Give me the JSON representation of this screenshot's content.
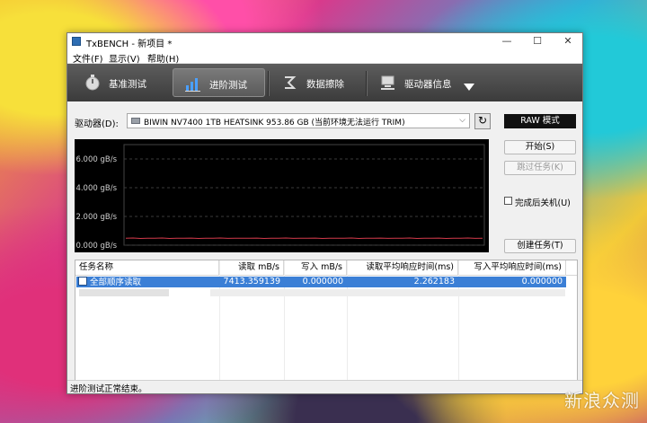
{
  "window": {
    "title": "TxBENCH - 新项目 *"
  },
  "controls": {
    "minimize": "—",
    "maximize": "☐",
    "close": "✕"
  },
  "menu": [
    "文件(F)",
    "显示(V)",
    "帮助(H)"
  ],
  "toolbar": {
    "tabs": [
      {
        "label": "基准测试",
        "icon": "stopwatch-icon",
        "active": false
      },
      {
        "label": "进阶测试",
        "icon": "bar-chart-icon",
        "active": true
      },
      {
        "label": "数据擦除",
        "icon": "erase-icon",
        "active": false
      },
      {
        "label": "驱动器信息",
        "icon": "drive-info-icon",
        "active": false
      }
    ]
  },
  "drive": {
    "label": "驱动器(D):",
    "selected": "BIWIN NV7400 1TB HEATSINK  953.86 GB (当前环境无法运行 TRIM)"
  },
  "right_panel": {
    "mode": "RAW 模式",
    "start": "开始(S)",
    "skip": "跳过任务(K)",
    "shutdown": "完成后关机(U)",
    "create": "创建任务(T)"
  },
  "chart_data": {
    "type": "line",
    "yticks": [
      "6.000 gB/s",
      "4.000 gB/s",
      "2.000 gB/s",
      "0.000 gB/s"
    ],
    "ylim": [
      0,
      7000
    ],
    "grid": true,
    "series": [
      {
        "values": [
          480,
          500,
          470,
          490,
          480,
          500,
          470,
          485,
          480,
          495,
          470,
          490,
          480,
          500,
          475,
          490,
          485,
          480,
          495,
          470,
          490,
          480,
          500,
          475,
          490,
          480,
          495,
          470,
          485,
          490,
          480,
          500,
          470,
          490,
          480,
          495,
          475,
          490,
          480,
          500,
          470,
          485,
          480,
          495,
          470,
          490,
          480,
          500,
          475,
          490
        ],
        "color": "#d23a4a"
      }
    ]
  },
  "table": {
    "headers": [
      "任务名称",
      "读取 mB/s",
      "写入 mB/s",
      "读取平均响应时间(ms)",
      "写入平均响应时间(ms)"
    ],
    "rows": [
      {
        "name": "全部顺序读取",
        "read": "7413.359139",
        "write": "0.000000",
        "read_lat": "2.262183",
        "write_lat": "0.000000"
      }
    ]
  },
  "status": "进阶测试正常结束。",
  "watermark": "新浪众测"
}
